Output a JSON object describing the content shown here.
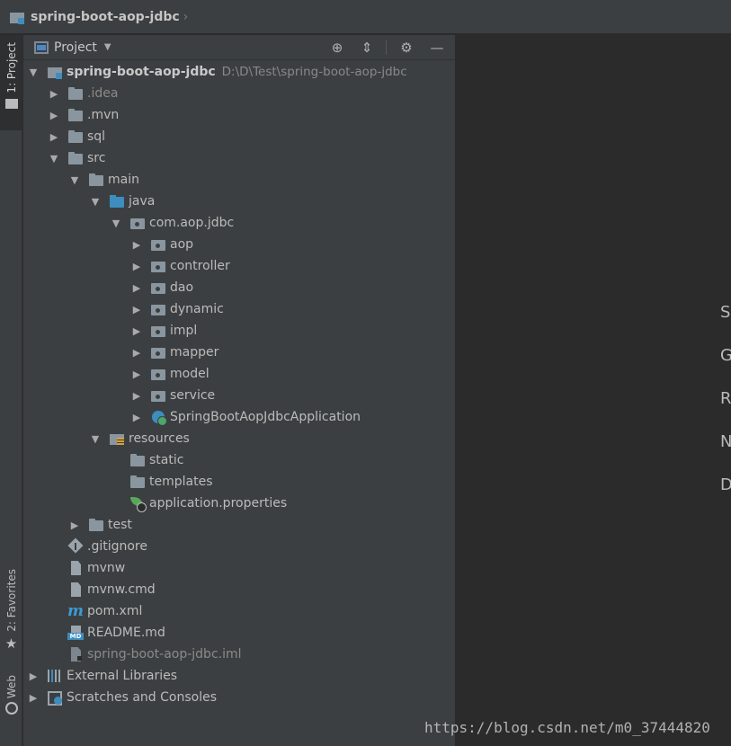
{
  "breadcrumb": {
    "project_name": "spring-boot-aop-jdbc"
  },
  "left_strip": {
    "project_tab": "1: Project",
    "favorites_tab": "2: Favorites",
    "web_tab": "Web"
  },
  "panel": {
    "title": "Project"
  },
  "tree": {
    "root": {
      "label": "spring-boot-aop-jdbc",
      "path": "D:\\D\\Test\\spring-boot-aop-jdbc"
    },
    "idea": ".idea",
    "mvn": ".mvn",
    "sql": "sql",
    "src": "src",
    "main": "main",
    "java": "java",
    "package": "com.aop.jdbc",
    "packages": [
      "aop",
      "controller",
      "dao",
      "dynamic",
      "impl",
      "mapper",
      "model",
      "service"
    ],
    "app_class": "SpringBootAopJdbcApplication",
    "resources": "resources",
    "static": "static",
    "templates": "templates",
    "app_props": "application.properties",
    "test": "test",
    "gitignore": ".gitignore",
    "mvnw": "mvnw",
    "mvnw_cmd": "mvnw.cmd",
    "pom": "pom.xml",
    "readme": "README.md",
    "iml": "spring-boot-aop-jdbc.iml",
    "ext_libs": "External Libraries",
    "scratches": "Scratches and Consoles"
  },
  "editor": {
    "hints": [
      "S",
      "G",
      "R",
      "N",
      "D"
    ]
  },
  "watermark": "https://blog.csdn.net/m0_37444820"
}
